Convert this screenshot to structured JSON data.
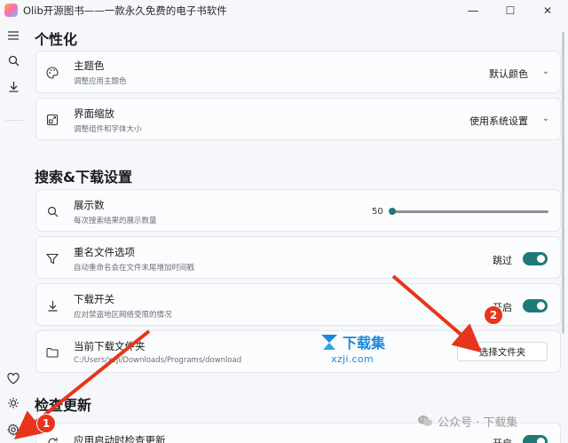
{
  "window": {
    "title": "Olib开源图书——一款永久免费的电子书软件",
    "minimize_glyph": "—",
    "maximize_glyph": "☐",
    "close_glyph": "✕"
  },
  "rail": {
    "top_icons": [
      "menu-icon",
      "search-icon",
      "download-icon"
    ],
    "bottom_icons": [
      "heart-icon",
      "theme-sun-icon",
      "settings-gear-icon"
    ]
  },
  "sections": {
    "personalize": {
      "title": "个性化"
    },
    "search_download": {
      "title": "搜索&下载设置"
    },
    "update": {
      "title": "检查更新"
    }
  },
  "settings": {
    "theme": {
      "icon": "palette-icon",
      "title": "主题色",
      "subtitle": "调整应用主题色",
      "value": "默认颜色"
    },
    "scale": {
      "icon": "zoom-frame-icon",
      "title": "界面缩放",
      "subtitle": "调整组件和字体大小",
      "value": "使用系统设置"
    },
    "results": {
      "icon": "search-icon",
      "title": "展示数",
      "subtitle": "每次搜索结果的展示数量",
      "value": "50",
      "slider_fraction": 0.0
    },
    "rename": {
      "icon": "filter-icon",
      "title": "重名文件选项",
      "subtitle": "自动重命名会在文件末尾增加时间戳",
      "toggle_label": "跳过"
    },
    "download_switch": {
      "icon": "download-icon",
      "title": "下载开关",
      "subtitle": "应对禁盗地区网络受限的情况",
      "toggle_label": "开启"
    },
    "folder": {
      "icon": "folder-icon",
      "title": "当前下载文件夹",
      "subtitle": "C:/Users/xzji/Downloads/Programs/download",
      "button": "选择文件夹"
    },
    "auto_update": {
      "icon": "refresh-icon",
      "title": "应用启动时检查更新",
      "toggle_label": "开启"
    }
  },
  "overlay": {
    "badge1": "1",
    "badge2": "2",
    "arrow_color": "#e8341c",
    "watermark_name": "下载集",
    "watermark_url": "xzji.com",
    "wechat": "公众号 · 下载集"
  },
  "colors": {
    "accent": "#1f7a77",
    "annotation": "#e8341c",
    "watermark": "#1e88d8"
  }
}
